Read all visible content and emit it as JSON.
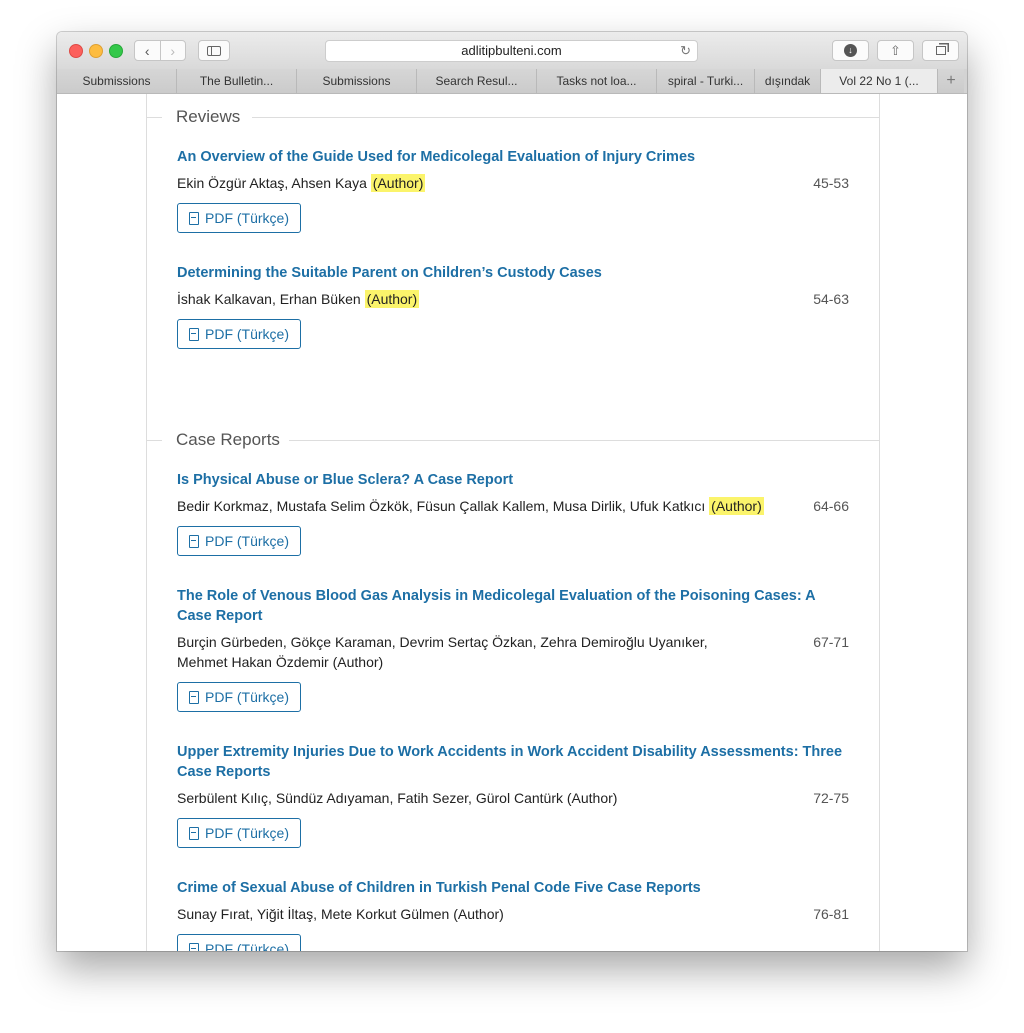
{
  "browser": {
    "url": "adlitipbulteni.com",
    "tabs": [
      {
        "label": "Submissions"
      },
      {
        "label": "The Bulletin..."
      },
      {
        "label": "Submissions"
      },
      {
        "label": "Search Resul..."
      },
      {
        "label": "Tasks not loa..."
      },
      {
        "label": "spiral - Turki..."
      },
      {
        "label": "dışındak"
      },
      {
        "label": "Vol 22 No 1 (..."
      }
    ],
    "new_tab": "+"
  },
  "sections": [
    {
      "title": "Reviews",
      "articles": [
        {
          "title": "An Overview of the Guide Used for Medicolegal Evaluation of Injury Crimes",
          "authors": "Ekin Özgür Aktaş, Ahsen Kaya",
          "role": "(Author)",
          "pages": "45-53",
          "pdf": "PDF (Türkçe)"
        },
        {
          "title": "Determining the Suitable Parent on Children’s Custody Cases",
          "authors": "İshak Kalkavan, Erhan Büken",
          "role": "(Author)",
          "pages": "54-63",
          "pdf": "PDF (Türkçe)"
        }
      ]
    },
    {
      "title": "Case Reports",
      "articles": [
        {
          "title": "Is Physical Abuse or Blue Sclera? A Case Report",
          "authors": "Bedir Korkmaz, Mustafa Selim Özkök, Füsun Çallak Kallem, Musa Dirlik, Ufuk Katkıcı",
          "role": "(Author)",
          "pages": "64-66",
          "pdf": "PDF (Türkçe)"
        },
        {
          "title": "The Role of Venous Blood Gas Analysis in Medicolegal Evaluation of the Poisoning Cases: A Case Report",
          "authors": "Burçin Gürbeden, Gökçe Karaman, Devrim Sertaç Özkan, Zehra Demiroğlu Uyanıker, Mehmet Hakan Özdemir",
          "role": "(Author)",
          "pages": "67-71",
          "pdf": "PDF (Türkçe)"
        },
        {
          "title": "Upper Extremity Injuries Due to Work Accidents in Work Accident Disability Assessments: Three Case Reports",
          "authors": "Serbülent Kılıç, Sündüz Adıyaman, Fatih Sezer, Gürol Cantürk",
          "role": "(Author)",
          "pages": "72-75",
          "pdf": "PDF (Türkçe)"
        },
        {
          "title": "Crime of Sexual Abuse of Children in Turkish Penal Code Five Case Reports",
          "authors": "Sunay Fırat, Yiğit İltaş, Mete Korkut Gülmen",
          "role": "(Author)",
          "pages": "76-81",
          "pdf": "PDF (Türkçe)"
        }
      ]
    }
  ],
  "colors": {
    "link": "#1d6fa5",
    "highlight": "#fbf46b"
  }
}
